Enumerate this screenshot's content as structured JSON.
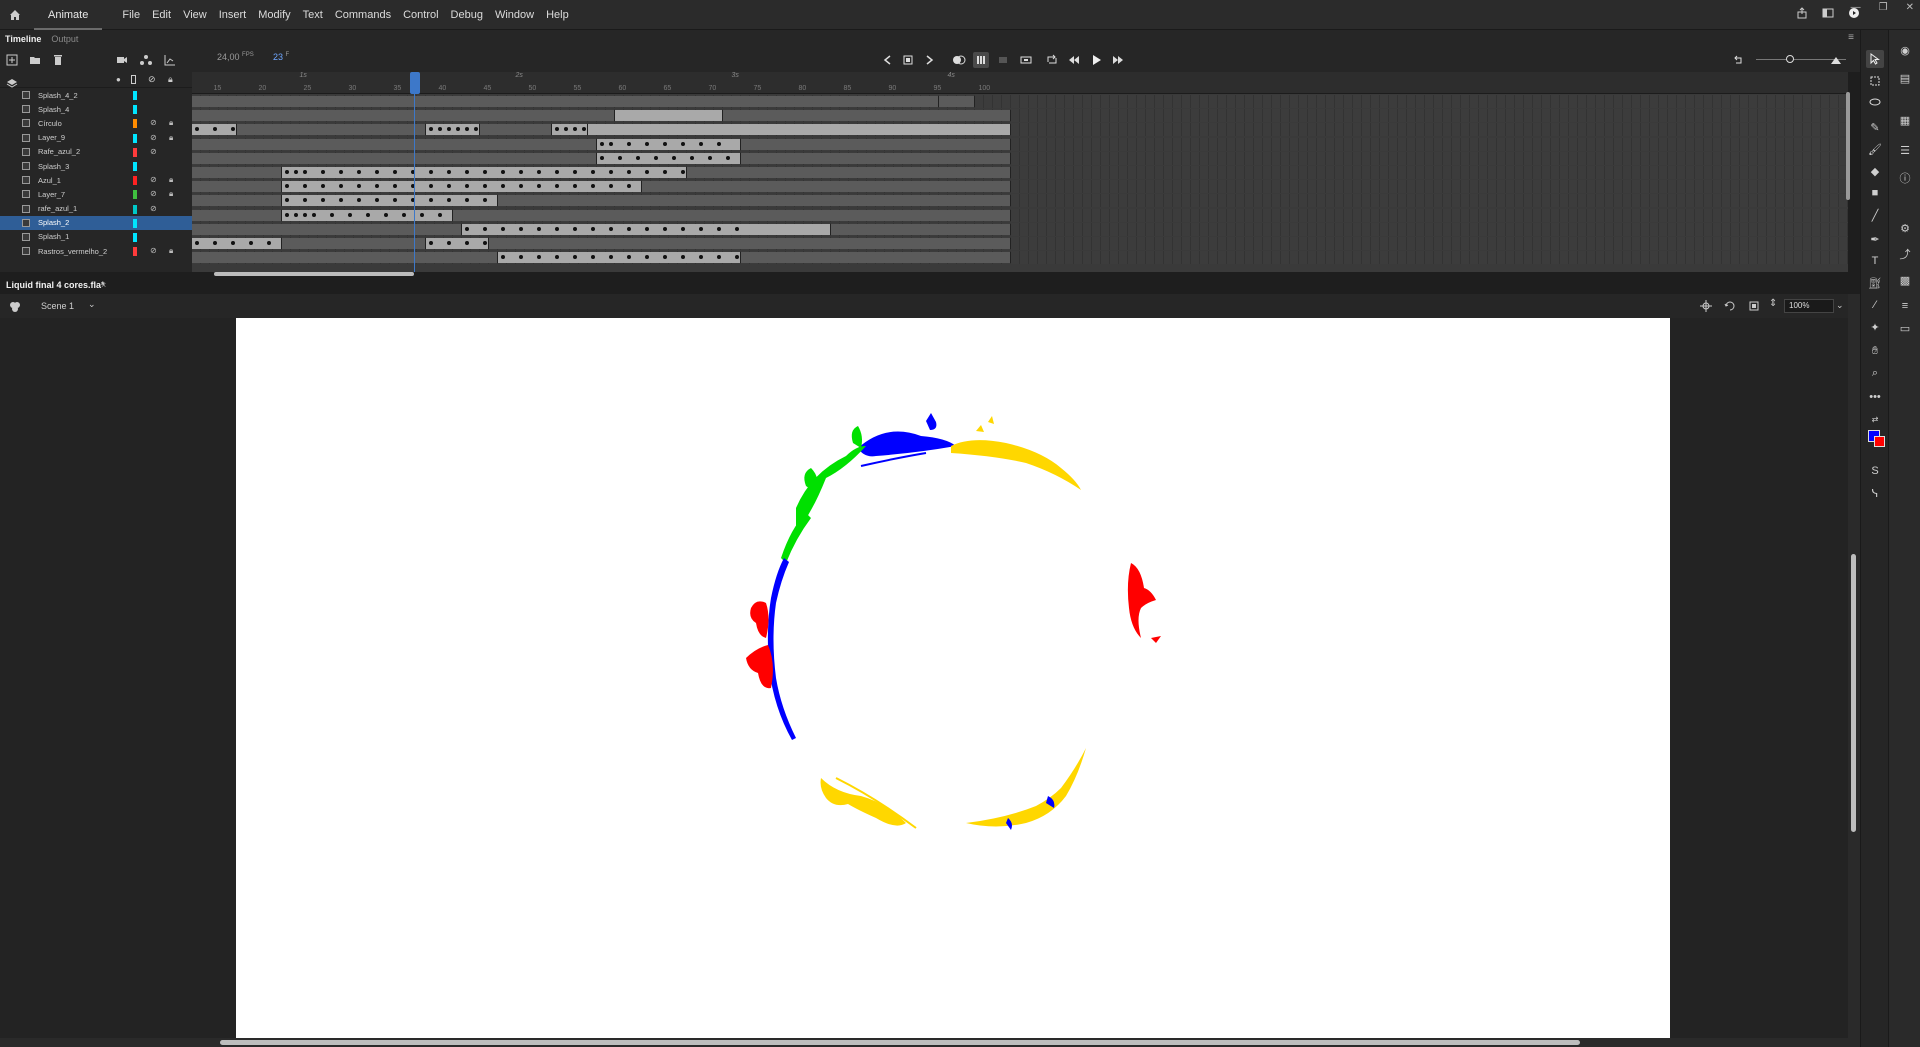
{
  "app": {
    "workspace_tab": "Animate"
  },
  "menu": [
    "File",
    "Edit",
    "View",
    "Insert",
    "Modify",
    "Text",
    "Commands",
    "Control",
    "Debug",
    "Window",
    "Help"
  ],
  "panel_tabs": {
    "timeline": "Timeline",
    "output": "Output"
  },
  "timeline": {
    "fps_value": "24,00",
    "fps_unit": "FPS",
    "current_frame": "23",
    "frame_unit": "F",
    "ruler_ticks": [
      "15",
      "20",
      "25",
      "30",
      "35",
      "40",
      "45",
      "50",
      "55",
      "60",
      "65",
      "70",
      "75",
      "80",
      "85",
      "90",
      "95",
      "100"
    ],
    "ruler_seconds": [
      "1s",
      "2s",
      "3s",
      "4s"
    ],
    "layers": [
      {
        "name": "Splash_4_2",
        "color": "#00e5ff",
        "hidden": false,
        "locked": false
      },
      {
        "name": "Splash_4",
        "color": "#00e5ff",
        "hidden": false,
        "locked": false
      },
      {
        "name": "Círculo",
        "color": "#ff8c00",
        "hidden": true,
        "locked": true
      },
      {
        "name": "Layer_9",
        "color": "#00e5ff",
        "hidden": true,
        "locked": true
      },
      {
        "name": "Rafe_azul_2",
        "color": "#ff3b3b",
        "hidden": true,
        "locked": false
      },
      {
        "name": "Splash_3",
        "color": "#00e5ff",
        "hidden": false,
        "locked": false
      },
      {
        "name": "Azul_1",
        "color": "#ff2222",
        "hidden": true,
        "locked": true
      },
      {
        "name": "Layer_7",
        "color": "#3fbf3f",
        "hidden": true,
        "locked": true
      },
      {
        "name": "rafe_azul_1",
        "color": "#00c8c8",
        "hidden": true,
        "locked": false
      },
      {
        "name": "Splash_2",
        "color": "#00e5ff",
        "hidden": false,
        "locked": false,
        "selected": true
      },
      {
        "name": "Splash_1",
        "color": "#00e5ff",
        "hidden": false,
        "locked": false
      },
      {
        "name": "Rastros_vermelho_2",
        "color": "#ff3b3b",
        "hidden": true,
        "locked": true
      }
    ]
  },
  "document": {
    "tab_title": "Liquid final 4 cores.fla*",
    "close": "×"
  },
  "edit_bar": {
    "scene": "Scene 1",
    "zoom": "100%"
  },
  "colors": {
    "stroke": "#0000ff",
    "fill": "#ff0000",
    "accent": "#3d78c9"
  },
  "artwork": {
    "splash_colors": [
      "#0000ff",
      "#00e000",
      "#ffd700",
      "#ff0000"
    ]
  }
}
